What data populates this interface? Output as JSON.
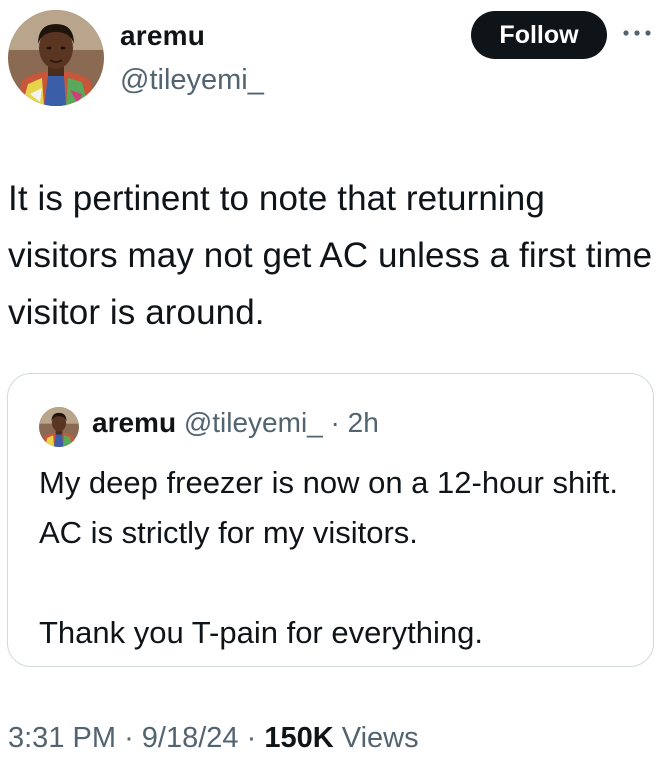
{
  "author": {
    "name": "aremu",
    "handle": "@tileyemi_"
  },
  "actions": {
    "follow_label": "Follow",
    "more_icon": "more-horizontal-icon"
  },
  "tweet": {
    "text": "It is pertinent to note that returning visitors may not get AC unless a first time visitor is around."
  },
  "quoted_tweet": {
    "name": "aremu",
    "handle": "@tileyemi_",
    "separator": "·",
    "time": "2h",
    "paragraphs": [
      "My deep freezer is now on a 12-hour shift. AC is strictly for my visitors.",
      "Thank you T-pain for everything."
    ]
  },
  "meta": {
    "time": "3:31 PM",
    "date": "9/18/24",
    "separator": "·",
    "views_count": "150K",
    "views_label": "Views"
  },
  "colors": {
    "text_primary": "#0f1419",
    "text_secondary": "#536471",
    "border": "#cfd9de",
    "follow_bg": "#0f1419",
    "follow_text": "#ffffff"
  }
}
